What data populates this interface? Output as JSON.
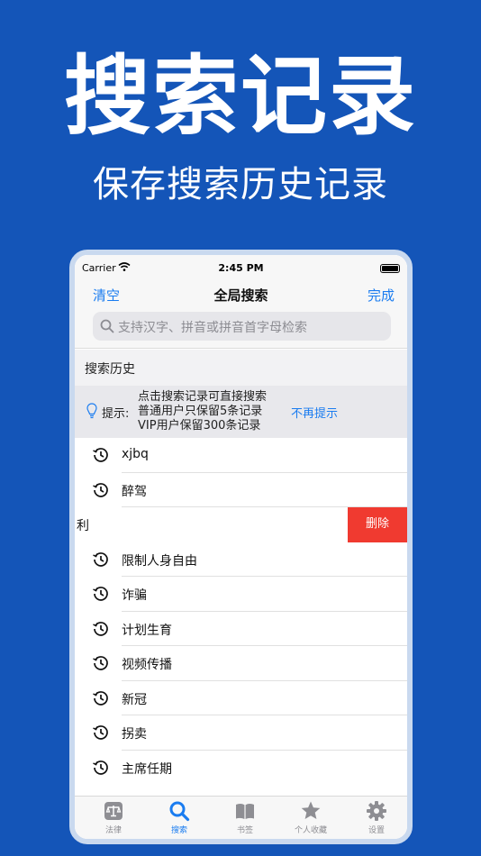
{
  "promo": {
    "title": "搜索记录",
    "subtitle": "保存搜索历史记录"
  },
  "status_bar": {
    "carrier": "Carrier",
    "time": "2:45 PM"
  },
  "nav": {
    "left": "清空",
    "title": "全局搜索",
    "right": "完成"
  },
  "search": {
    "placeholder": "支持汉字、拼音或拼音首字母检索"
  },
  "section": {
    "title": "搜索历史"
  },
  "tip": {
    "label": "提示:",
    "line1": "点击搜索记录可直接搜索",
    "line2": "普通用户只保留5条记录",
    "line3": "VIP用户保留300条记录",
    "dismiss": "不再提示"
  },
  "history": [
    {
      "text": "xjbq"
    },
    {
      "text": "醉驾"
    },
    {
      "text": "利",
      "swiped": true,
      "delete_label": "删除"
    },
    {
      "text": "限制人身自由"
    },
    {
      "text": "诈骗"
    },
    {
      "text": "计划生育"
    },
    {
      "text": "视频传播"
    },
    {
      "text": "新冠"
    },
    {
      "text": "拐卖"
    },
    {
      "text": "主席任期"
    }
  ],
  "tabs": [
    {
      "label": "法律",
      "icon": "law-icon",
      "active": false
    },
    {
      "label": "搜索",
      "icon": "search-icon",
      "active": true
    },
    {
      "label": "书签",
      "icon": "book-icon",
      "active": false
    },
    {
      "label": "个人收藏",
      "icon": "star-icon",
      "active": false
    },
    {
      "label": "设置",
      "icon": "gear-icon",
      "active": false
    }
  ],
  "colors": {
    "background": "#1455b8",
    "accent": "#1a7cf0",
    "delete": "#f03a30"
  }
}
